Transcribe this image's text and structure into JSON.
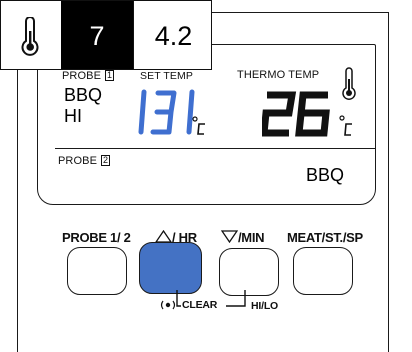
{
  "infobar": {
    "thermometer_icon": "thermometer-icon",
    "probe_number": "7",
    "reading": "4.2"
  },
  "lcd": {
    "probe1_label": "PROBE",
    "probe1_index": "1",
    "set_temp_label": "SET TEMP",
    "thermo_temp_label": "THERMO TEMP",
    "probe1_mode": "BBQ",
    "probe1_level": "HI",
    "set_temp_value": "131",
    "set_temp_unit": "°C",
    "thermo_temp_value": "26",
    "thermo_temp_unit": "°C",
    "probe2_label": "PROBE",
    "probe2_index": "2",
    "probe2_mode": "BBQ"
  },
  "buttons": {
    "probe_label": "PROBE 1/ 2",
    "up_label": "/ HR",
    "down_label": "/MIN",
    "meat_label": "MEAT/ST./SP",
    "clear_label": "CLEAR",
    "hilo_label": "HI/LO",
    "active_button": "up"
  },
  "colors": {
    "lcd_digits_blue": "#3f6fd0",
    "active_button": "#4472c4"
  }
}
